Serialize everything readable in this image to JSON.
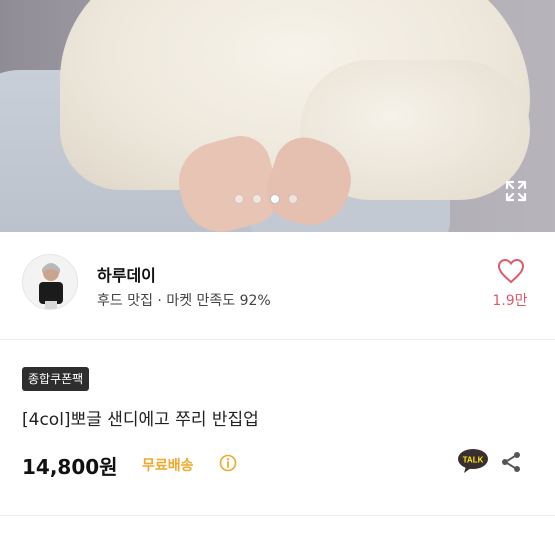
{
  "product_image": {
    "carousel": {
      "count": 4,
      "active_index": 3
    },
    "icons": {
      "expand": "expand-icon"
    }
  },
  "shop": {
    "name": "하루데이",
    "subtitle": "후드 맛집 · 마켓 만족도 92%",
    "like_count": "1.9만",
    "icons": {
      "like": "heart-icon"
    }
  },
  "product": {
    "coupon_badge": "종합쿠폰팩",
    "title": "[4col]뽀글 샌디에고 쭈리 반집업",
    "price": "14,800원",
    "shipping": "무료배송",
    "icons": {
      "info": "info-icon",
      "talk": "kakaotalk-icon",
      "share": "share-icon"
    },
    "talk_label": "TALK"
  },
  "colors": {
    "accent_shipping": "#f0a72a",
    "heart": "#e05a6b",
    "badge_bg": "#2e2e2e",
    "talk_bg": "#3a2f2f"
  }
}
